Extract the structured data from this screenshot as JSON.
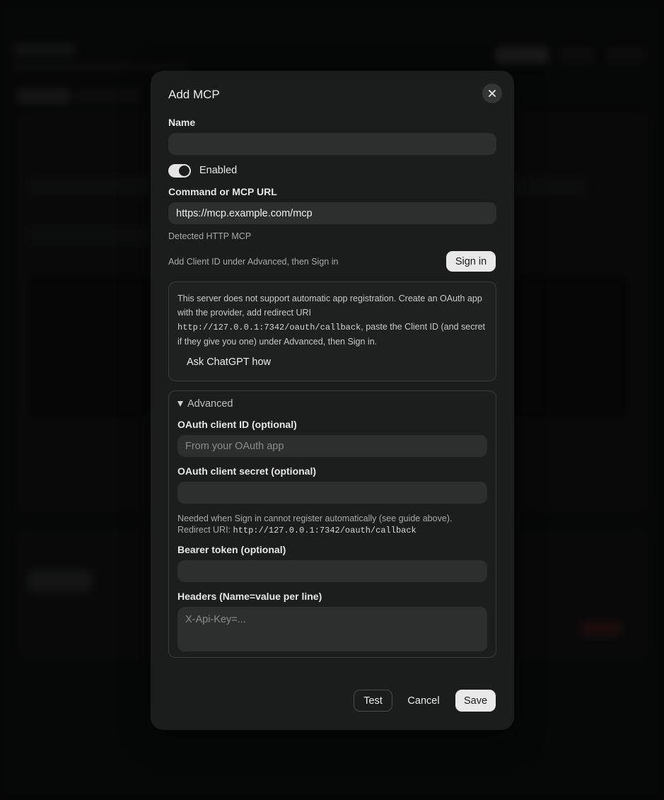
{
  "modal": {
    "title": "Add MCP",
    "close_icon": "close-icon",
    "name_label": "Name",
    "name_value": "",
    "enabled_label": "Enabled",
    "enabled_on": true,
    "command_label": "Command or MCP URL",
    "command_value": "https://mcp.example.com/mcp",
    "detected_text": "Detected HTTP MCP",
    "signin_hint": "Add Client ID under Advanced, then Sign in",
    "signin_label": "Sign in",
    "info": {
      "text_before": "This server does not support automatic app registration. Create an OAuth app with the provider, add redirect URI ",
      "redirect_uri": "http://127.0.0.1:7342/oauth/callback",
      "text_after": ", paste the Client ID (and secret if they give you one) under Advanced, then Sign in.",
      "ask_label": "Ask ChatGPT how"
    },
    "advanced": {
      "summary": "Advanced",
      "client_id_label": "OAuth client ID (optional)",
      "client_id_placeholder": "From your OAuth app",
      "client_secret_label": "OAuth client secret (optional)",
      "help_line1": "Needed when Sign in cannot register automatically (see guide above).",
      "help_line2_prefix": "Redirect URI: ",
      "help_redirect_uri": "http://127.0.0.1:7342/oauth/callback",
      "bearer_label": "Bearer token (optional)",
      "headers_label": "Headers (Name=value per line)",
      "headers_placeholder": "X-Api-Key=..."
    },
    "footer": {
      "test_label": "Test",
      "cancel_label": "Cancel",
      "save_label": "Save"
    }
  }
}
